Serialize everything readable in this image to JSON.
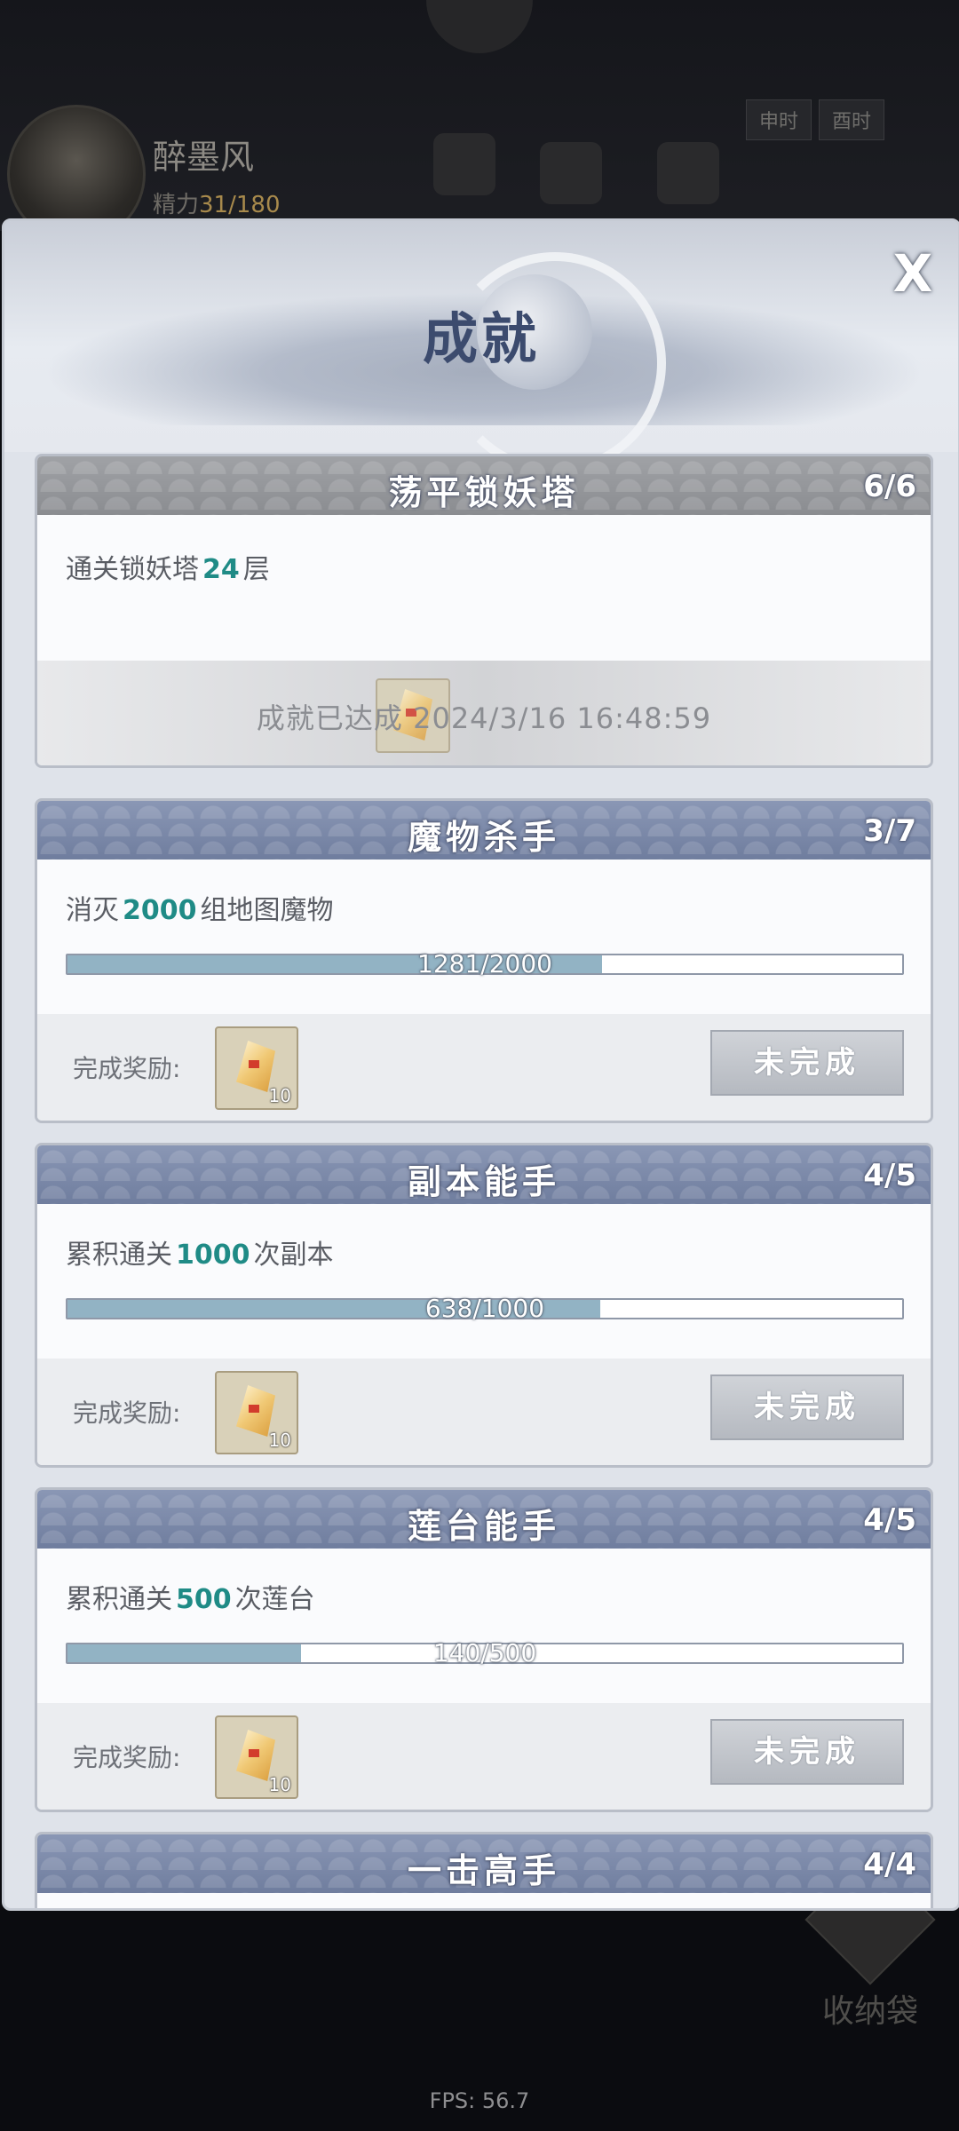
{
  "background": {
    "player_name": "醉墨风",
    "energy_label": "精力",
    "energy_value": "31/180",
    "time_tabs": [
      "申时",
      "酉时"
    ],
    "bag_label": "收纳袋",
    "fps": "FPS: 56.7"
  },
  "modal": {
    "title": "成就",
    "close_label": "X",
    "reward_label": "完成奖励:",
    "status_incomplete": "未完成",
    "cards": [
      {
        "title": "荡平锁妖塔",
        "count": "6/6",
        "desc_prefix": "通关锁妖塔",
        "desc_value": "24",
        "desc_suffix": "层",
        "completed_text": "成就已达成 2024/3/16 16:48:59"
      },
      {
        "title": "魔物杀手",
        "count": "3/7",
        "desc_prefix": "消灭",
        "desc_value": "2000",
        "desc_suffix": "组地图魔物",
        "progress_text": "1281/2000",
        "progress": 0.6405,
        "reward_qty": "10"
      },
      {
        "title": "副本能手",
        "count": "4/5",
        "desc_prefix": "累积通关",
        "desc_value": "1000",
        "desc_suffix": "次副本",
        "progress_text": "638/1000",
        "progress": 0.638,
        "reward_qty": "10"
      },
      {
        "title": "莲台能手",
        "count": "4/5",
        "desc_prefix": "累积通关",
        "desc_value": "500",
        "desc_suffix": "次莲台",
        "progress_text": "140/500",
        "progress": 0.28,
        "reward_qty": "10"
      },
      {
        "title": "一击高手",
        "count": "4/4"
      }
    ]
  }
}
